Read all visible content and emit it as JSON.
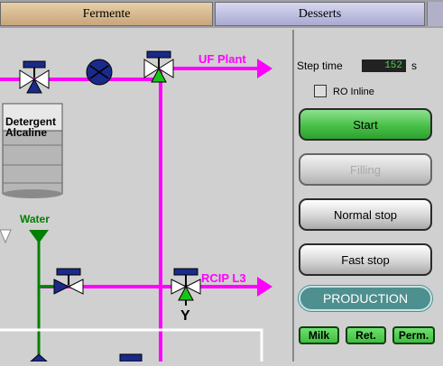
{
  "tabs": [
    {
      "label": "Fermente"
    },
    {
      "label": "Desserts"
    }
  ],
  "diagram": {
    "uf_plant_label": "UF Plant",
    "rcip_label": "RCIP L3",
    "detergent_label_line1": "Detergent",
    "detergent_label_line2": "Alcaline",
    "water_label": "Water",
    "y_label": "Y",
    "colors": {
      "pipe_magenta": "#ff00ff",
      "pipe_green": "#008000",
      "valve_blue": "#1a2a8a"
    }
  },
  "panel": {
    "step_time_label": "Step time",
    "step_time_value": "152",
    "step_time_unit": "s",
    "ro_inline_label": "RO Inline",
    "ro_inline_checked": false,
    "buttons": {
      "start": "Start",
      "filling": "Filling",
      "normal_stop": "Normal stop",
      "fast_stop": "Fast stop"
    },
    "mode": "PRODUCTION",
    "small_buttons": {
      "milk": "Milk",
      "ret": "Ret.",
      "perm": "Perm."
    }
  }
}
